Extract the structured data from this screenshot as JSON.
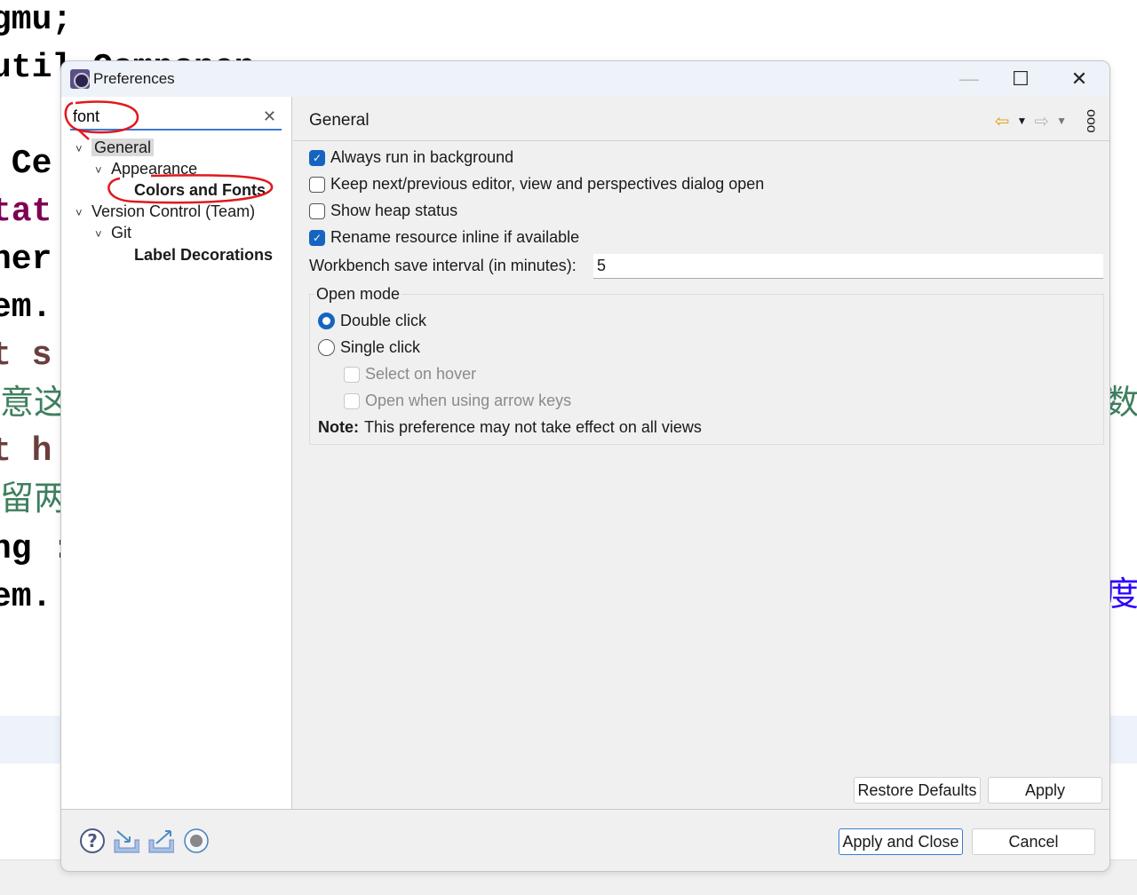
{
  "background_code": {
    "left_lines": [
      {
        "text": "gmu;",
        "color": "#000000"
      },
      {
        "text": "util.Componen",
        "color": "#000000"
      },
      {
        "text": " Ce",
        "color": "#000000"
      },
      {
        "text": "tat",
        "color": "#7f0055"
      },
      {
        "text": "her",
        "color": "#000000"
      },
      {
        "text": "em.",
        "color": "#000000"
      },
      {
        "text": "t s",
        "color": "#6a3e3e"
      },
      {
        "text": "意这",
        "color": "#3f7f5f"
      },
      {
        "text": "t h",
        "color": "#6a3e3e"
      },
      {
        "text": "留两",
        "color": "#3f7f5f"
      },
      {
        "text": "ng :",
        "color": "#000000"
      },
      {
        "text": "em.",
        "color": "#000000"
      }
    ],
    "right_fragments": [
      {
        "text": "数,",
        "color": "#3f7f5f"
      },
      {
        "text": "度",
        "color": "#2a00ff"
      }
    ]
  },
  "dialog": {
    "title": "Preferences",
    "window_controls": {
      "minimize": "—",
      "maximize": "☐",
      "close": "✕"
    },
    "search": {
      "value": "font",
      "clear": "✕"
    },
    "tree": [
      {
        "label": "General",
        "chevron": "˅",
        "selected": true,
        "bold": false
      },
      {
        "label": "Appearance",
        "chevron": "˅",
        "bold": false
      },
      {
        "label": "Colors and Fonts",
        "bold": true
      },
      {
        "label": "Version Control (Team)",
        "chevron": "˅",
        "bold": false
      },
      {
        "label": "Git",
        "chevron": "˅",
        "bold": false
      },
      {
        "label": "Label Decorations",
        "bold": true
      }
    ],
    "page": {
      "title": "General",
      "checkboxes": [
        {
          "label": "Always run in background",
          "checked": true
        },
        {
          "label": "Keep next/previous editor, view and perspectives dialog open",
          "checked": false
        },
        {
          "label": "Show heap status",
          "checked": false
        },
        {
          "label": "Rename resource inline if available",
          "checked": true
        }
      ],
      "save_interval": {
        "label": "Workbench save interval (in minutes):",
        "value": "5"
      },
      "open_mode": {
        "label": "Open mode",
        "radios": [
          {
            "label": "Double click",
            "selected": true
          },
          {
            "label": "Single click",
            "selected": false
          }
        ],
        "sub_options": [
          {
            "label": "Select on hover",
            "checked": false,
            "disabled": true
          },
          {
            "label": "Open when using arrow keys",
            "checked": false,
            "disabled": true
          }
        ],
        "note_label": "Note:",
        "note_text": "This preference may not take effect on all views"
      },
      "restore_defaults": "Restore Defaults",
      "apply": "Apply"
    },
    "footer": {
      "apply_close": "Apply and Close",
      "cancel": "Cancel"
    },
    "accent": "#1565c0",
    "annotation_color": "#e0191e"
  }
}
